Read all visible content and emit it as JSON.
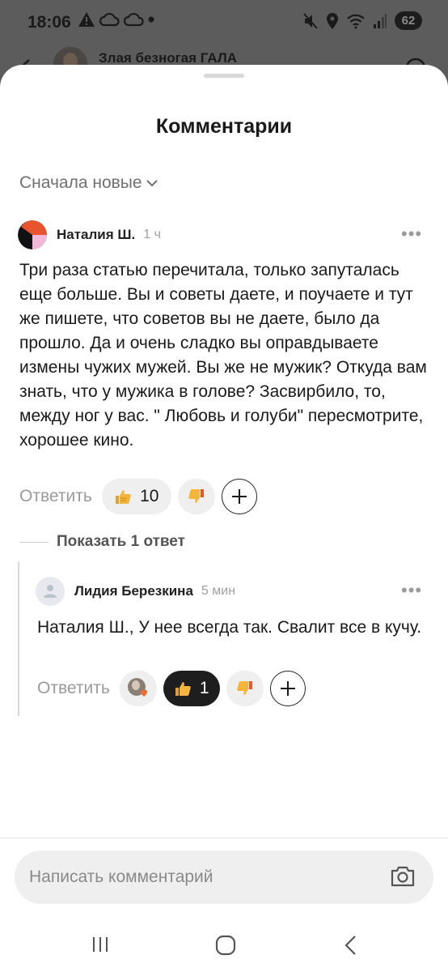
{
  "status": {
    "time": "18:06",
    "battery": "62"
  },
  "background_page": {
    "channel_name": "Злая безногая ГАЛА"
  },
  "sheet": {
    "title": "Комментарии",
    "sort_label": "Сначала новые"
  },
  "comment": {
    "author": "Наталия Ш.",
    "time": "1 ч",
    "text": "Три раза статью перечитала, только запуталась еще больше. Вы и советы даете, и поучаете и тут же пишете, что советов вы не даете, было да прошло. Да и очень сладко вы оправдываете измены чужих мужей. Вы же не мужик? Откуда вам знать, что у мужика в голове? Засвирбило, то, между ног у вас. \" Любовь и голуби\" пересмотрите, хорошее кино.",
    "reply_label": "Ответить",
    "likes": "10",
    "show_replies": "Показать 1 ответ"
  },
  "reply": {
    "author": "Лидия Березкина",
    "time": "5 мин",
    "text": "Наталия Ш., У нее всегда так. Свалит все в кучу.",
    "reply_label": "Ответить",
    "likes": "1"
  },
  "composer": {
    "placeholder": "Написать комментарий"
  }
}
